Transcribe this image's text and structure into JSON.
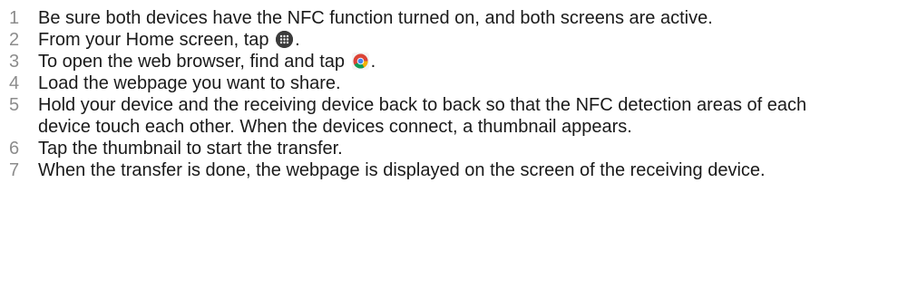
{
  "steps": [
    {
      "num": "1",
      "text": "Be sure both devices have the NFC function turned on, and both screens are active."
    },
    {
      "num": "2",
      "before": "From your Home screen, tap",
      "icon": "apps-grid-icon",
      "after": "."
    },
    {
      "num": "3",
      "before": "To open the web browser, find and tap",
      "icon": "chrome-browser-icon",
      "after": "."
    },
    {
      "num": "4",
      "text": "Load the webpage you want to share."
    },
    {
      "num": "5",
      "text": "Hold your device and the receiving device back to back so that the NFC detection areas of each device touch each other. When the devices connect, a thumbnail appears."
    },
    {
      "num": "6",
      "text": "Tap the thumbnail to start the transfer."
    },
    {
      "num": "7",
      "text": "When the transfer is done, the webpage is displayed on the screen of the receiving device."
    }
  ]
}
